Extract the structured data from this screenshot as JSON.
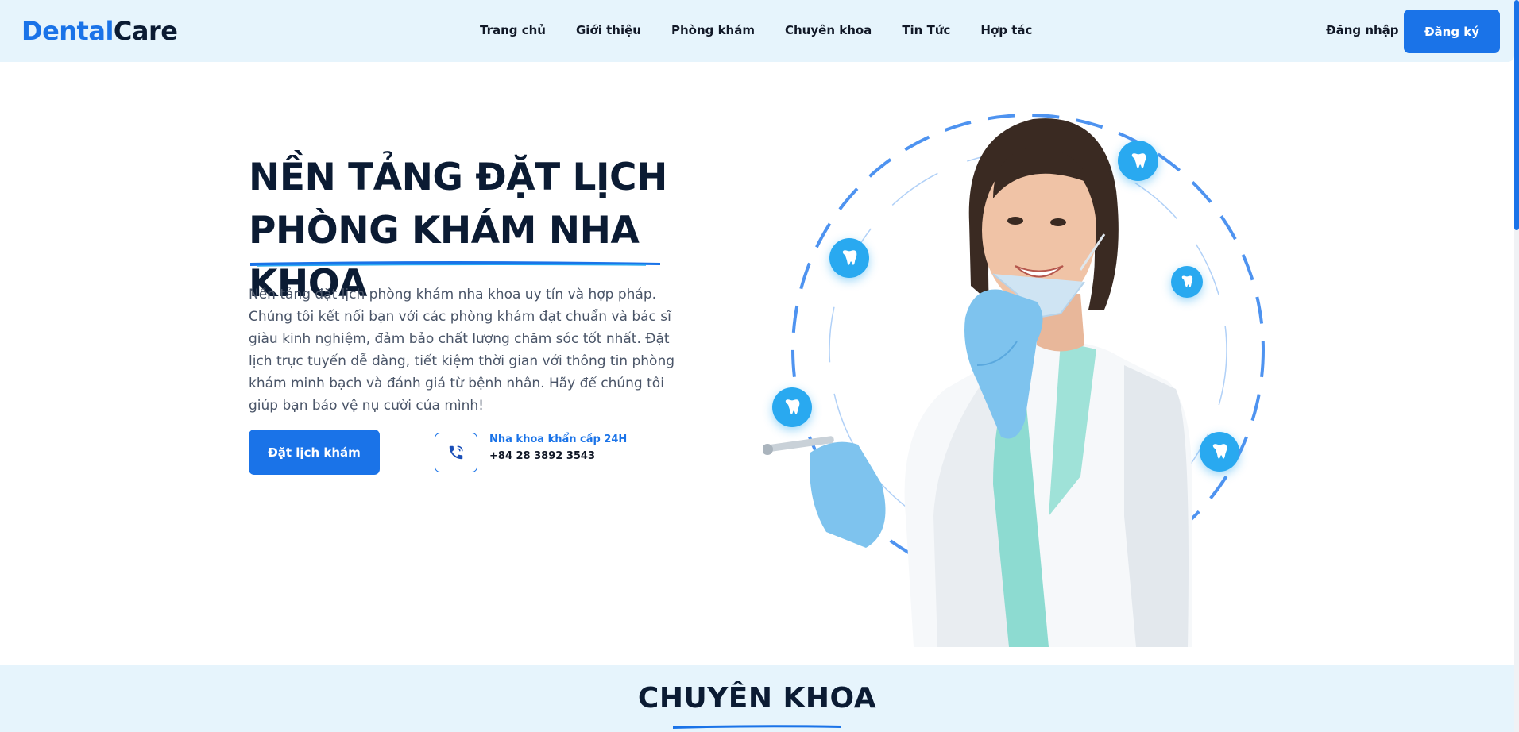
{
  "brand": {
    "part1": "Dental",
    "part2": "Care"
  },
  "nav": {
    "items": [
      "Trang chủ",
      "Giới thiệu",
      "Phòng khám",
      "Chuyên khoa",
      "Tin Tức",
      "Hợp tác"
    ],
    "login_label": "Đăng nhập",
    "signup_label": "Đăng ký"
  },
  "hero": {
    "title_line1": "NỀN TẢNG ĐẶT LỊCH",
    "title_line2": "PHÒNG KHÁM NHA KHOA",
    "description": "Nền tảng đặt lịch phòng khám nha khoa uy tín và hợp pháp. Chúng tôi kết nối bạn với các phòng khám đạt chuẩn và bác sĩ giàu kinh nghiệm, đảm bảo chất lượng chăm sóc tốt nhất. Đặt lịch trực tuyến dễ dàng, tiết kiệm thời gian với thông tin phòng khám minh bạch và đánh giá từ bệnh nhân. Hãy để chúng tôi giúp bạn bảo vệ nụ cười của mình!",
    "book_button": "Đặt lịch khám",
    "emergency_label": "Nha khoa khẩn cấp 24H",
    "emergency_phone": "+84 28 3892 3543"
  },
  "specialty": {
    "title": "CHUYÊN KHOA"
  },
  "colors": {
    "primary": "#1a73e8",
    "nav_bg": "#e6f4fc",
    "heading": "#0b1b33",
    "tooth_badge": "#29a9f0"
  },
  "icons": {
    "phone": "phone-call-icon",
    "tooth": "tooth-icon"
  }
}
